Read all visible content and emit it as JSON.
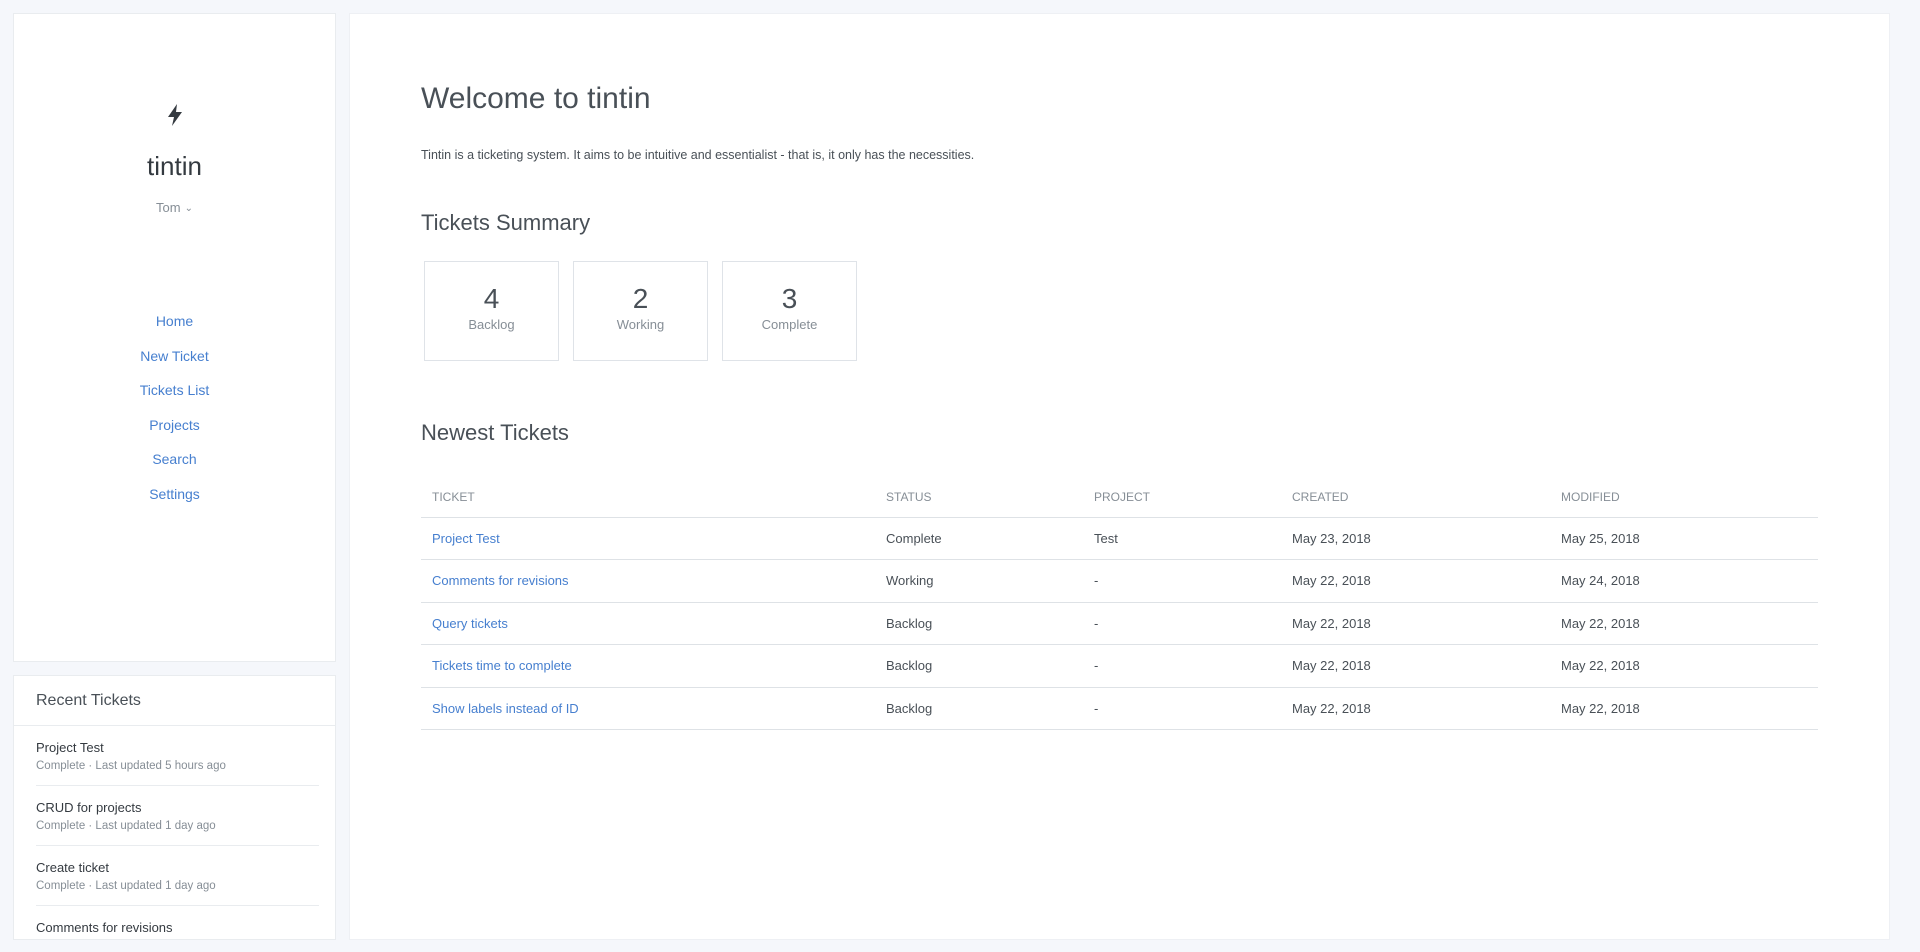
{
  "sidebar": {
    "brand": "tintin",
    "user": "Tom",
    "nav": [
      "Home",
      "New Ticket",
      "Tickets List",
      "Projects",
      "Search",
      "Settings"
    ]
  },
  "recent": {
    "title": "Recent Tickets",
    "items": [
      {
        "title": "Project Test",
        "status": "Complete · Last updated 5 hours ago"
      },
      {
        "title": "CRUD for projects",
        "status": "Complete · Last updated 1 day ago"
      },
      {
        "title": "Create ticket",
        "status": "Complete · Last updated 1 day ago"
      },
      {
        "title": "Comments for revisions",
        "status": ""
      }
    ]
  },
  "main": {
    "welcome": "Welcome to tintin",
    "intro": "Tintin is a ticketing system. It aims to be intuitive and essentialist - that is, it only has the necessities.",
    "summary_title": "Tickets Summary",
    "summary": [
      {
        "count": "4",
        "label": "Backlog"
      },
      {
        "count": "2",
        "label": "Working"
      },
      {
        "count": "3",
        "label": "Complete"
      }
    ],
    "newest_title": "Newest Tickets",
    "columns": [
      "TICKET",
      "STATUS",
      "PROJECT",
      "CREATED",
      "MODIFIED"
    ],
    "rows": [
      [
        "Project Test",
        "Complete",
        "Test",
        "May 23, 2018",
        "May 25, 2018"
      ],
      [
        "Comments for revisions",
        "Working",
        "-",
        "May 22, 2018",
        "May 24, 2018"
      ],
      [
        "Query tickets",
        "Backlog",
        "-",
        "May 22, 2018",
        "May 22, 2018"
      ],
      [
        "Tickets time to complete",
        "Backlog",
        "-",
        "May 22, 2018",
        "May 22, 2018"
      ],
      [
        "Show labels instead of ID",
        "Backlog",
        "-",
        "May 22, 2018",
        "May 22, 2018"
      ]
    ]
  },
  "colors": {
    "link": "#467fcf",
    "muted": "#868e96",
    "text": "#495057"
  },
  "icons": {
    "brand": "lightning-bolt-icon",
    "user_menu": "chevron-down-icon"
  }
}
